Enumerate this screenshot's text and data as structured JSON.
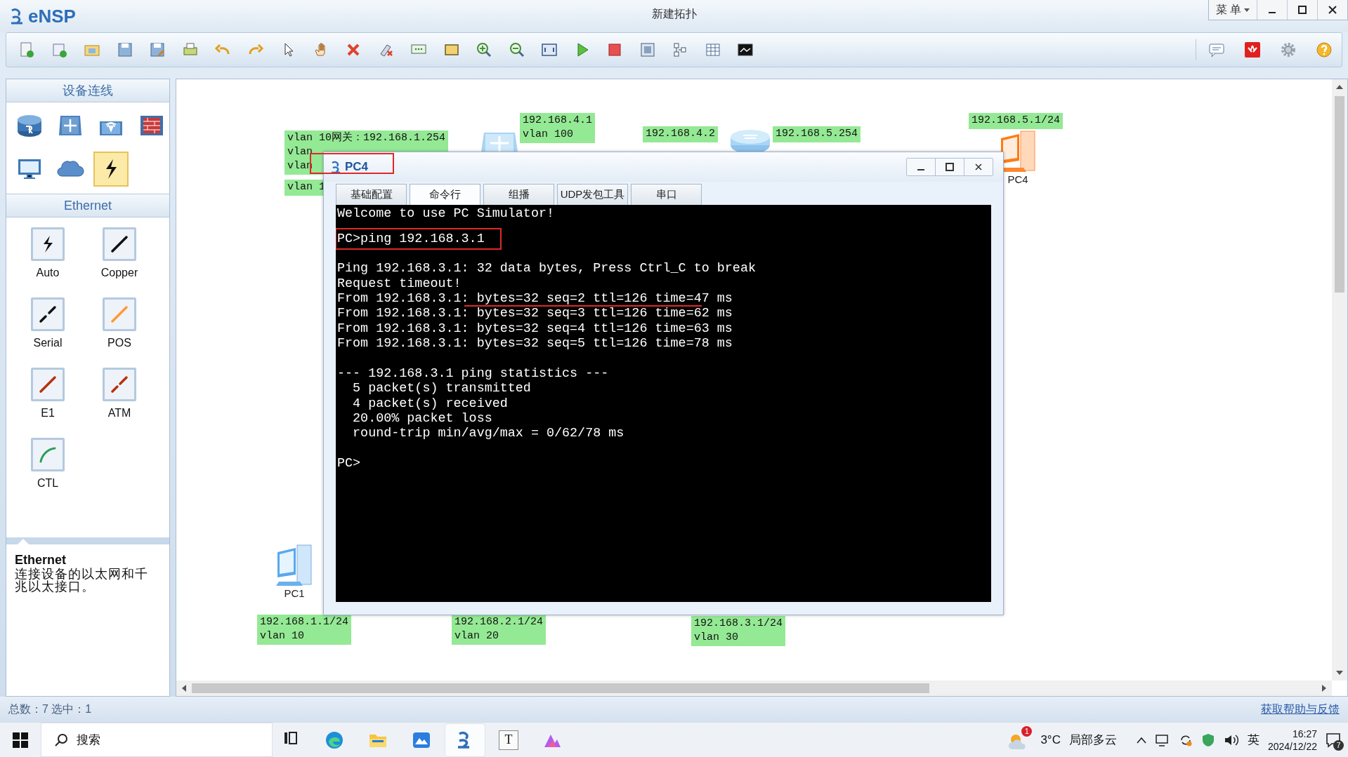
{
  "app": {
    "name": "eNSP",
    "title": "新建拓扑",
    "menu": "菜 单"
  },
  "sidebar": {
    "devices_header": "设备连线",
    "devices": [
      {
        "kind": "router",
        "selected": false
      },
      {
        "kind": "switch",
        "selected": false
      },
      {
        "kind": "wireless",
        "selected": false
      },
      {
        "kind": "firewall",
        "selected": false
      },
      {
        "kind": "pc",
        "selected": false
      },
      {
        "kind": "cloud",
        "selected": false
      },
      {
        "kind": "cable",
        "selected": true
      }
    ],
    "cables_header": "Ethernet",
    "cables": [
      {
        "kind": "auto",
        "label": "Auto"
      },
      {
        "kind": "copper",
        "label": "Copper"
      },
      {
        "kind": "serial",
        "label": "Serial"
      },
      {
        "kind": "pos",
        "label": "POS"
      },
      {
        "kind": "e1",
        "label": "E1"
      },
      {
        "kind": "atm",
        "label": "ATM"
      },
      {
        "kind": "ctl",
        "label": "CTL"
      }
    ],
    "info": {
      "title": "Ethernet",
      "text": "连接设备的以太网和千兆以太接口。"
    }
  },
  "canvas": {
    "labels": [
      {
        "lines": [
          "vlan 10网关：192.168.1.254",
          "vlan",
          "vlan"
        ]
      },
      {
        "lines": [
          "vlan 1"
        ]
      },
      {
        "lines": [
          "192.168.4.1",
          "vlan 100"
        ]
      },
      {
        "lines": [
          "192.168.4.2"
        ]
      },
      {
        "lines": [
          "192.168.5.254"
        ]
      },
      {
        "lines": [
          "192.168.5.1/24"
        ]
      },
      {
        "lines": [
          "192.168.1.1/24",
          "vlan 10"
        ]
      },
      {
        "lines": [
          "192.168.2.1/24",
          "vlan 20"
        ]
      },
      {
        "lines": [
          "192.168.3.1/24",
          "vlan 30"
        ]
      }
    ],
    "nodes": [
      {
        "kind": "switch"
      },
      {
        "kind": "router"
      },
      {
        "kind": "pc",
        "label": "PC4"
      },
      {
        "kind": "pc",
        "label": "PC1"
      }
    ]
  },
  "pc_window": {
    "title": "PC4",
    "tabs": [
      {
        "label": "基础配置",
        "selected": false
      },
      {
        "label": "命令行",
        "selected": true
      },
      {
        "label": "组播",
        "selected": false
      },
      {
        "label": "UDP发包工具",
        "selected": false
      },
      {
        "label": "串口",
        "selected": false
      }
    ],
    "blocks": [
      [
        {
          "text": "Welcome to use PC Simulator!",
          "boxed": false,
          "underlined": false
        }
      ],
      [
        {
          "text": "PC>ping 192.168.3.1",
          "boxed": true,
          "underlined": false
        }
      ],
      [
        {
          "text": "Ping 192.168.3.1: 32 data bytes, Press Ctrl_C to break",
          "boxed": false,
          "underlined": false
        },
        {
          "text": "Request timeout!",
          "boxed": false,
          "underlined": false
        },
        {
          "text": "From 192.168.3.1: bytes=32 seq=2 ttl=126 time=47 ms",
          "boxed": false,
          "underlined": true
        },
        {
          "text": "From 192.168.3.1: bytes=32 seq=3 ttl=126 time=62 ms",
          "boxed": false,
          "underlined": false
        },
        {
          "text": "From 192.168.3.1: bytes=32 seq=4 ttl=126 time=63 ms",
          "boxed": false,
          "underlined": false
        },
        {
          "text": "From 192.168.3.1: bytes=32 seq=5 ttl=126 time=78 ms",
          "boxed": false,
          "underlined": false
        }
      ],
      [
        {
          "text": "--- 192.168.3.1 ping statistics ---",
          "boxed": false,
          "underlined": false
        },
        {
          "text": "  5 packet(s) transmitted",
          "boxed": false,
          "underlined": false
        },
        {
          "text": "  4 packet(s) received",
          "boxed": false,
          "underlined": false
        },
        {
          "text": "  20.00% packet loss",
          "boxed": false,
          "underlined": false
        },
        {
          "text": "  round-trip min/avg/max = 0/62/78 ms",
          "boxed": false,
          "underlined": false
        }
      ],
      [
        {
          "text": "PC>",
          "boxed": false,
          "underlined": false
        }
      ]
    ]
  },
  "status_bar": {
    "summary": "总数：7 选中：1",
    "help_link": "获取帮助与反馈"
  },
  "taskbar": {
    "search": "搜索",
    "apps": [
      {
        "kind": "edge",
        "selected": false
      },
      {
        "kind": "folder",
        "selected": false
      },
      {
        "kind": "cloud-app",
        "selected": false
      },
      {
        "kind": "ensp",
        "selected": true
      },
      {
        "kind": "text-app",
        "label": "T",
        "selected": false
      },
      {
        "kind": "paint",
        "selected": false
      }
    ],
    "weather_badge": "1",
    "temperature": "3°C",
    "weather": "局部多云",
    "ime": "英",
    "time": "16:27",
    "date": "2024/12/22",
    "notifications": "7"
  }
}
